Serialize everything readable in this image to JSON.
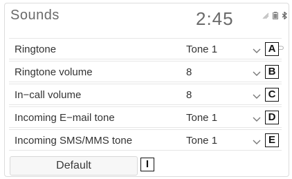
{
  "header": {
    "title": "Sounds",
    "clock": "2:45"
  },
  "status_icons": [
    "bluetooth-muted-icon",
    "battery-icon",
    "bluetooth-icon"
  ],
  "rows": [
    {
      "label": "Ringtone",
      "value": "Tone 1",
      "callout": "A"
    },
    {
      "label": "Ringtone volume",
      "value": "8",
      "callout": "B"
    },
    {
      "label": "In−call volume",
      "value": "8",
      "callout": "C"
    },
    {
      "label": "Incoming E−mail tone",
      "value": "Tone 1",
      "callout": "D"
    },
    {
      "label": "Incoming SMS/MMS tone",
      "value": "Tone 1",
      "callout": "E"
    }
  ],
  "default_button": {
    "label": "Default",
    "callout": "I"
  }
}
